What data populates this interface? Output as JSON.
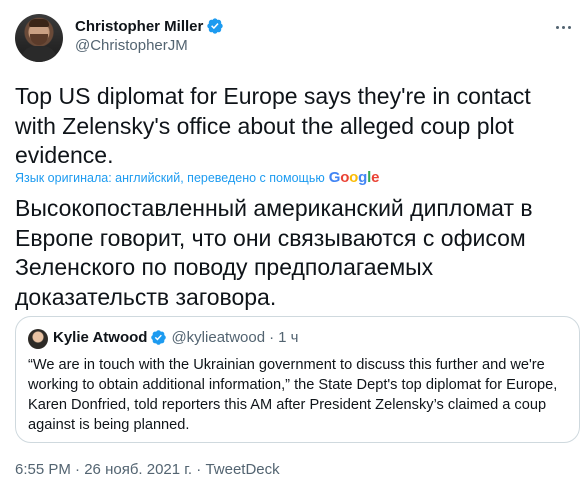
{
  "author": {
    "name": "Christopher Miller",
    "handle": "@ChristopherJM",
    "verified_color": "#1d9bf0"
  },
  "tweet": {
    "text": "Top US diplomat for Europe says they're in contact with Zelensky's office about the alleged coup plot evidence.",
    "translation_label": "Язык оригинала: английский, переведено с помощью",
    "translation_provider": {
      "g1": "G",
      "o1": "o",
      "o2": "o",
      "g2": "g",
      "l": "l",
      "e": "e"
    },
    "translated_text": "Высокопоставленный американский дипломат в Европе говорит, что они связываются с офисом Зеленского по поводу предполагаемых доказательств заговора."
  },
  "quote": {
    "name": "Kylie Atwood",
    "handle": "@kylieatwood",
    "separator": "·",
    "time": "1 ч",
    "text": "“We are in touch with the Ukrainian government to discuss this further and we're working to obtain additional information,” the State Dept's top diplomat for Europe, Karen Donfried, told reporters this AM after President Zelensky’s claimed a coup against is being planned."
  },
  "meta": {
    "time": "6:55 PM",
    "date": "26 нояб. 2021 г.",
    "source": "TweetDeck",
    "separator": "·"
  },
  "icons": {
    "more": "more-horizontal-icon",
    "verified": "verified-badge-icon"
  }
}
